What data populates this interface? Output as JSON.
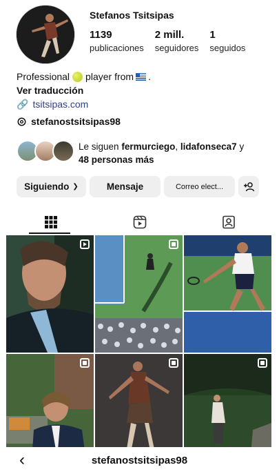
{
  "profile": {
    "display_name": "Stefanos Tsitsipas",
    "stats": [
      {
        "value": "1139",
        "label": "publicaciones"
      },
      {
        "value": "2 mill.",
        "label": "seguidores"
      },
      {
        "value": "1",
        "label": "seguidos"
      }
    ],
    "bio_prefix": "Professional",
    "bio_suffix": "player from",
    "bio_end": ".",
    "translate": "Ver traducción",
    "link": "tsitsipas.com",
    "threads_handle": "stefanostsitsipas98",
    "followed_by_prefix": "Le siguen",
    "followed_by_name1": "fermurciego",
    "followed_by_sep": ",",
    "followed_by_name2": "lidafonseca7",
    "followed_by_and": " y",
    "followed_by_more": "48 personas más"
  },
  "actions": {
    "following_label": "Siguiendo",
    "message_label": "Mensaje",
    "email_label": "Correo elect..."
  },
  "tabs": [
    "grid-icon",
    "reels-icon",
    "tagged-icon"
  ],
  "footer": {
    "title": "stefanostsitsipas98"
  }
}
